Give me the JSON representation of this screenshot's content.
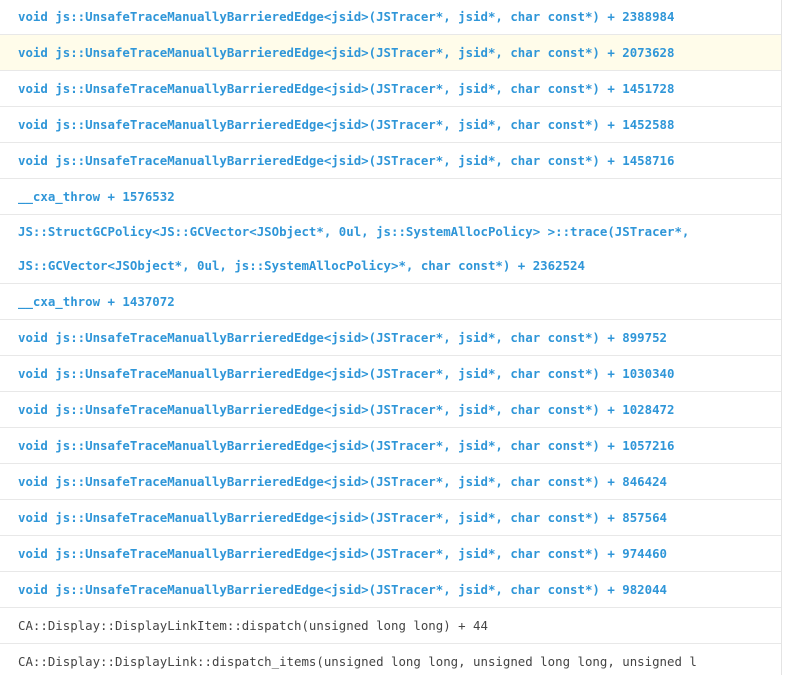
{
  "frames": [
    {
      "text": "void js::UnsafeTraceManuallyBarrieredEdge<jsid>(JSTracer*, jsid*, char const*) + 2388984",
      "kind": "link"
    },
    {
      "text": "void js::UnsafeTraceManuallyBarrieredEdge<jsid>(JSTracer*, jsid*, char const*) + 2073628",
      "kind": "link",
      "highlighted": true
    },
    {
      "text": "void js::UnsafeTraceManuallyBarrieredEdge<jsid>(JSTracer*, jsid*, char const*) + 1451728",
      "kind": "link"
    },
    {
      "text": "void js::UnsafeTraceManuallyBarrieredEdge<jsid>(JSTracer*, jsid*, char const*) + 1452588",
      "kind": "link"
    },
    {
      "text": "void js::UnsafeTraceManuallyBarrieredEdge<jsid>(JSTracer*, jsid*, char const*) + 1458716",
      "kind": "link"
    },
    {
      "text": "__cxa_throw + 1576532",
      "kind": "link"
    },
    {
      "text": "JS::StructGCPolicy<JS::GCVector<JSObject*, 0ul, js::SystemAllocPolicy> >::trace(JSTracer*, JS::GCVector<JSObject*, 0ul, js::SystemAllocPolicy>*, char const*) + 2362524",
      "kind": "link",
      "wrap": true
    },
    {
      "text": "__cxa_throw + 1437072",
      "kind": "link"
    },
    {
      "text": "void js::UnsafeTraceManuallyBarrieredEdge<jsid>(JSTracer*, jsid*, char const*) + 899752",
      "kind": "link"
    },
    {
      "text": "void js::UnsafeTraceManuallyBarrieredEdge<jsid>(JSTracer*, jsid*, char const*) + 1030340",
      "kind": "link"
    },
    {
      "text": "void js::UnsafeTraceManuallyBarrieredEdge<jsid>(JSTracer*, jsid*, char const*) + 1028472",
      "kind": "link"
    },
    {
      "text": "void js::UnsafeTraceManuallyBarrieredEdge<jsid>(JSTracer*, jsid*, char const*) + 1057216",
      "kind": "link"
    },
    {
      "text": "void js::UnsafeTraceManuallyBarrieredEdge<jsid>(JSTracer*, jsid*, char const*) + 846424",
      "kind": "link"
    },
    {
      "text": "void js::UnsafeTraceManuallyBarrieredEdge<jsid>(JSTracer*, jsid*, char const*) + 857564",
      "kind": "link"
    },
    {
      "text": "void js::UnsafeTraceManuallyBarrieredEdge<jsid>(JSTracer*, jsid*, char const*) + 974460",
      "kind": "link"
    },
    {
      "text": "void js::UnsafeTraceManuallyBarrieredEdge<jsid>(JSTracer*, jsid*, char const*) + 982044",
      "kind": "link"
    },
    {
      "text": "CA::Display::DisplayLinkItem::dispatch(unsigned long long) + 44",
      "kind": "plain"
    },
    {
      "text": "CA::Display::DisplayLink::dispatch_items(unsigned long long, unsigned long long, unsigned l",
      "kind": "plain"
    }
  ],
  "colors": {
    "link": "#2f96d8",
    "plain": "#444444",
    "highlight_bg": "#fffcea",
    "divider": "#e8e8e8"
  }
}
